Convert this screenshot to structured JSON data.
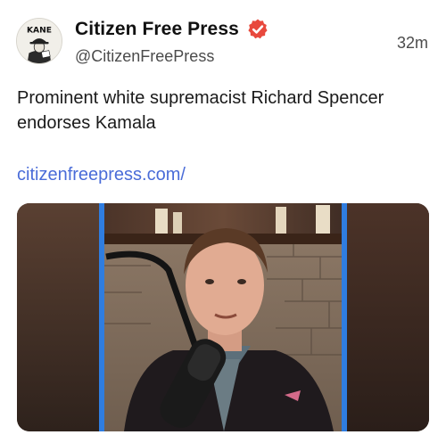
{
  "post": {
    "author": {
      "display_name": "Citizen Free Press",
      "handle": "@CitizenFreePress",
      "avatar_text": "KANE",
      "avatar_icon": "newsboy-logo-icon",
      "verified_icon": "verified-badge-icon",
      "verified_color": "#e8493d"
    },
    "timestamp": "32m",
    "text": "Prominent white supremacist Richard Spencer endorses Kamala",
    "link": {
      "label": "citizenfreepress.com/",
      "color": "#4a6cd8"
    },
    "media": {
      "type": "video-thumbnail",
      "frame_color": "#2f7de0"
    }
  }
}
